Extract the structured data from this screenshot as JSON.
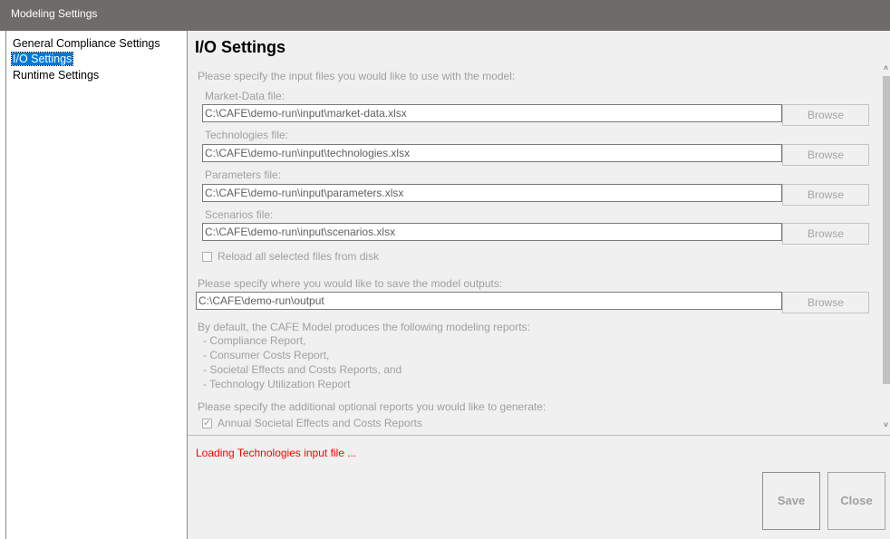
{
  "window": {
    "title": "Modeling Settings"
  },
  "sidebar": {
    "items": [
      {
        "label": "General Compliance Settings"
      },
      {
        "label": "I/O Settings"
      },
      {
        "label": "Runtime Settings"
      }
    ]
  },
  "main": {
    "title": "I/O Settings",
    "input_intro": "Please specify the input files you would like to use with the model:",
    "input_files": [
      {
        "label": "Market-Data file:",
        "value": "C:\\CAFE\\demo-run\\input\\market-data.xlsx",
        "button": "Browse"
      },
      {
        "label": "Technologies file:",
        "value": "C:\\CAFE\\demo-run\\input\\technologies.xlsx",
        "button": "Browse"
      },
      {
        "label": "Parameters file:",
        "value": "C:\\CAFE\\demo-run\\input\\parameters.xlsx",
        "button": "Browse"
      },
      {
        "label": "Scenarios file:",
        "value": "C:\\CAFE\\demo-run\\input\\scenarios.xlsx",
        "button": "Browse"
      }
    ],
    "reload_label": "Reload all selected files from disk",
    "reload_checked": false,
    "output_intro": "Please specify where you would like to save the model outputs:",
    "output_path": "C:\\CAFE\\demo-run\\output",
    "output_button": "Browse",
    "reports_intro": "By default, the CAFE Model produces the following modeling reports:",
    "reports": [
      "- Compliance Report,",
      "- Consumer Costs  Report,",
      "- Societal Effects and Costs Reports, and",
      "- Technology Utilization Report"
    ],
    "optional_intro": "Please specify the additional optional reports you would like to generate:",
    "optional_reports": [
      {
        "label": "Annual Societal Effects and Costs Reports",
        "checked": true
      }
    ]
  },
  "status": {
    "message": "Loading Technologies input file ..."
  },
  "buttons": {
    "save": "Save",
    "close": "Close"
  },
  "colors": {
    "selection": "#0078d7",
    "status_text": "#ff0000",
    "titlebar": "#6f6b6b"
  }
}
